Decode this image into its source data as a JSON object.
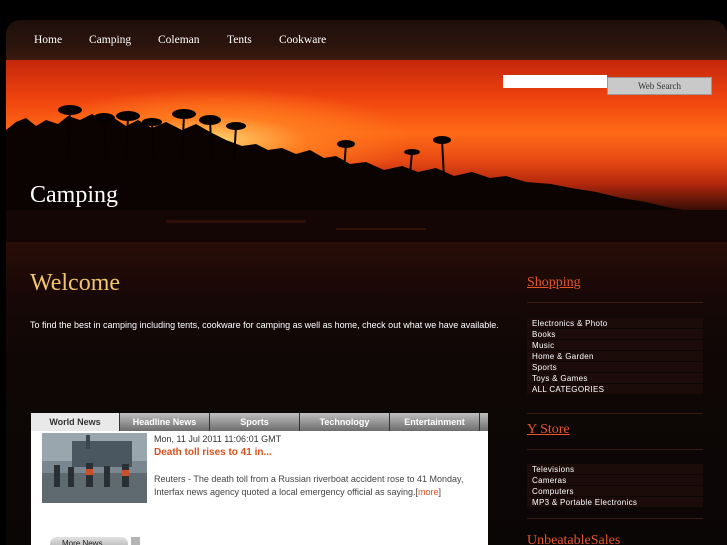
{
  "nav": {
    "items": [
      "Home",
      "Camping",
      "Coleman",
      "Tents",
      "Cookware"
    ]
  },
  "search": {
    "button_label": "Web Search",
    "value": ""
  },
  "hero": {
    "title": "Camping"
  },
  "main": {
    "heading": "Welcome",
    "intro": "To find the best in camping including tents, cookware for camping as well as home, check out what we have available."
  },
  "news": {
    "tabs": [
      "World News",
      "Headline News",
      "Sports",
      "Technology",
      "Entertainment"
    ],
    "active_tab": "World News",
    "date": "Mon, 11 Jul 2011 11:06:01 GMT",
    "headline": "Death toll rises to 41 in...",
    "body": "Reuters - The death toll from a Russian riverboat accident rose to 41 Monday, Interfax news agency quoted a local emergency official as saying.",
    "more_link": "more",
    "more_button": "More News"
  },
  "sidebar": {
    "shopping": {
      "title": "Shopping",
      "items": [
        "Electronics & Photo",
        "Books",
        "Music",
        "Home & Garden",
        "Sports",
        "Toys & Games",
        "ALL CATEGORIES"
      ]
    },
    "ystore": {
      "title": "Y Store",
      "items": [
        "Televisions",
        "Cameras",
        "Computers",
        "MP3 & Portable Electronics"
      ]
    },
    "unbeatable": {
      "title": "UnbeatableSales"
    }
  },
  "colors": {
    "accent": "#e8552a",
    "welcome": "#f1c56e",
    "headline": "#d8501c"
  }
}
